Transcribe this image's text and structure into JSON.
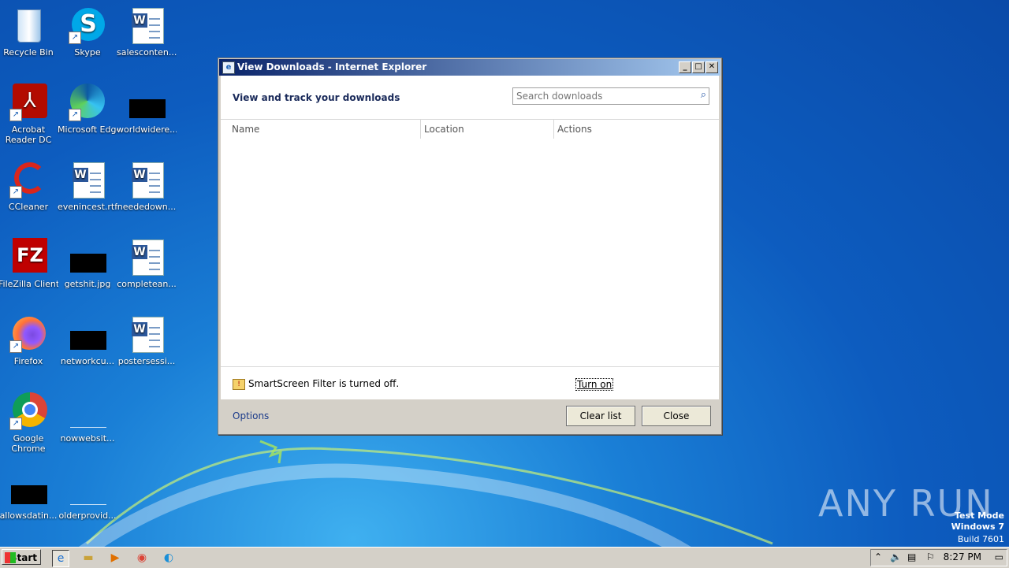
{
  "desktop": {
    "icons": [
      {
        "label": "Recycle Bin",
        "icon": "recycle-bin-icon"
      },
      {
        "label": "Skype",
        "icon": "skype-icon"
      },
      {
        "label": "salesconten...",
        "icon": "word-document-icon"
      },
      {
        "label": "Acrobat Reader DC",
        "icon": "acrobat-icon"
      },
      {
        "label": "Microsoft Edge",
        "icon": "edge-icon"
      },
      {
        "label": "worldwidere...",
        "icon": "black-thumbnail-icon"
      },
      {
        "label": "CCleaner",
        "icon": "ccleaner-icon"
      },
      {
        "label": "evenincest.rtf",
        "icon": "word-document-icon"
      },
      {
        "label": "neededown...",
        "icon": "word-document-icon"
      },
      {
        "label": "FileZilla Client",
        "icon": "filezilla-icon"
      },
      {
        "label": "getshit.jpg",
        "icon": "black-thumbnail-icon"
      },
      {
        "label": "completean...",
        "icon": "word-document-icon"
      },
      {
        "label": "Firefox",
        "icon": "firefox-icon"
      },
      {
        "label": "networkcu...",
        "icon": "black-thumbnail-icon"
      },
      {
        "label": "postersessi...",
        "icon": "word-document-icon"
      },
      {
        "label": "Google Chrome",
        "icon": "chrome-icon"
      },
      {
        "label": "nowwebsit...",
        "icon": "blank-file-icon"
      },
      {
        "label": "allowsdatin...",
        "icon": "black-thumbnail-icon"
      },
      {
        "label": "olderprovid...",
        "icon": "blank-file-icon"
      }
    ]
  },
  "dialog": {
    "title": "View Downloads - Internet Explorer",
    "heading": "View and track your downloads",
    "search_placeholder": "Search downloads",
    "columns": [
      "Name",
      "Location",
      "Actions"
    ],
    "smartscreen_text": "SmartScreen Filter is turned off.",
    "turn_on_link": "Turn on",
    "options_link": "Options",
    "clear_list_button": "Clear list",
    "close_button": "Close"
  },
  "watermark": {
    "brand": "ANY RUN",
    "mode": "Test Mode",
    "os": "Windows 7",
    "build": "Build 7601"
  },
  "taskbar": {
    "start_label": "Start",
    "clock": "8:27 PM"
  }
}
